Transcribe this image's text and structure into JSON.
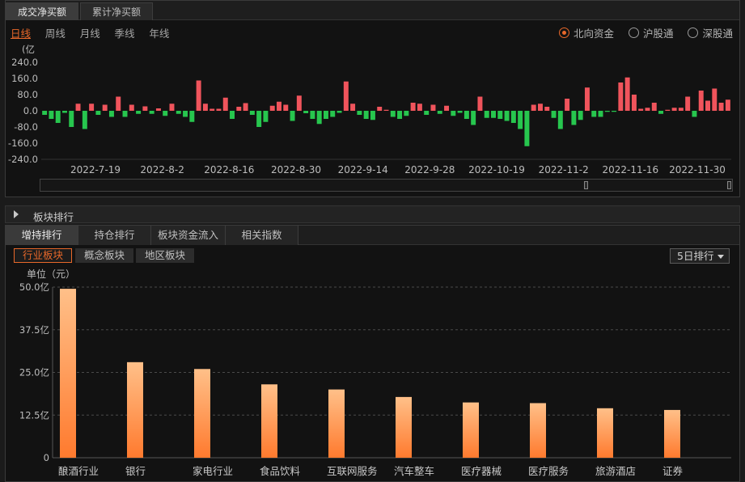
{
  "top_tabs": [
    "成交净买额",
    "累计净买额"
  ],
  "periods": [
    "日线",
    "周线",
    "月线",
    "季线",
    "年线"
  ],
  "channels": [
    "北向资金",
    "沪股通",
    "深股通"
  ],
  "section": {
    "title": "板块排行"
  },
  "sub_tabs": [
    "增持排行",
    "持仓排行",
    "板块资金流入",
    "相关指数"
  ],
  "segments": [
    "行业板块",
    "概念板块",
    "地区板块"
  ],
  "sort_select": "5日排行",
  "colors": {
    "accent": "#e8682a",
    "up": "#f0545c",
    "down": "#27c64e"
  },
  "chart_data": [
    {
      "type": "bar",
      "unit_label": "(亿",
      "ylim": [
        -240,
        240
      ],
      "yticks": [
        "240.0",
        "160.0",
        "80.0",
        "0.0",
        "-80.0",
        "-160.0",
        "-240.0"
      ],
      "xticks": [
        "2022-7-19",
        "2022-8-2",
        "2022-8-16",
        "2022-8-30",
        "2022-9-14",
        "2022-9-28",
        "2022-10-19",
        "2022-11-2",
        "2022-11-16",
        "2022-11-30"
      ],
      "values": [
        -20,
        -40,
        -60,
        -10,
        -80,
        35,
        -90,
        35,
        -20,
        30,
        -30,
        70,
        -30,
        30,
        -15,
        22,
        -15,
        12,
        -25,
        35,
        -15,
        -30,
        -55,
        150,
        35,
        10,
        10,
        65,
        -40,
        20,
        38,
        -20,
        -80,
        -55,
        25,
        45,
        30,
        -50,
        75,
        -12,
        -40,
        -65,
        -40,
        -30,
        -10,
        145,
        35,
        -20,
        -40,
        -45,
        20,
        5,
        -30,
        -40,
        -25,
        40,
        35,
        -20,
        30,
        -15,
        25,
        -25,
        -10,
        -40,
        -70,
        70,
        -35,
        -35,
        -40,
        -50,
        -60,
        -90,
        -175,
        30,
        35,
        20,
        -35,
        -90,
        60,
        -70,
        -45,
        115,
        -30,
        -30,
        -5,
        -5,
        140,
        165,
        80,
        10,
        15,
        40,
        -15,
        5,
        15,
        15,
        70,
        -30,
        100,
        50,
        110,
        40,
        55
      ]
    },
    {
      "type": "bar",
      "ylabel": "单位（元）",
      "ylim": [
        0,
        50
      ],
      "yticks": [
        "50.0亿",
        "37.5亿",
        "25.0亿",
        "12.5亿",
        "0"
      ],
      "categories": [
        "酿酒行业",
        "银行",
        "家电行业",
        "食品饮料",
        "互联网服务",
        "汽车整车",
        "医疗器械",
        "医疗服务",
        "旅游酒店",
        "证券"
      ],
      "values": [
        49.5,
        28.0,
        26.0,
        21.5,
        20.0,
        17.8,
        16.2,
        16.0,
        14.5,
        14.0
      ]
    }
  ]
}
